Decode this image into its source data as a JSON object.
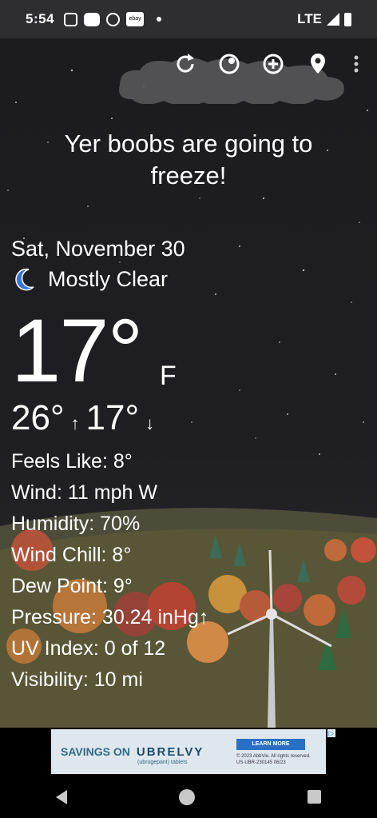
{
  "status": {
    "time": "5:54",
    "network": "LTE",
    "ebay_label": "ebay"
  },
  "weather": {
    "quip": "Yer boobs are going to freeze!",
    "date": "Sat, November 30",
    "condition": "Mostly Clear",
    "temp": "17°",
    "unit": "F",
    "high": "26°",
    "low": "17°",
    "high_arrow": "↑",
    "low_arrow": "↓"
  },
  "details": [
    "Feels Like:  8°",
    "Wind:  11 mph W",
    "Humidity:  70%",
    "Wind Chill:  8°",
    "Dew Point:  9°",
    "Pressure:  30.24 inHg↑",
    "UV Index:  0 of 12",
    "Visibility:  10 mi"
  ],
  "ad": {
    "headline": "SAVINGS ON",
    "brand": "UBRELVY",
    "sub": "(ubrogepant) tablets",
    "cta": "LEARN MORE",
    "legal1": "© 2023 AbbVie. All rights reserved.",
    "legal2": "US-UBR-230145 06/23"
  },
  "colors": {
    "background": "#1b1b1d",
    "moon": "#3a74d6"
  }
}
